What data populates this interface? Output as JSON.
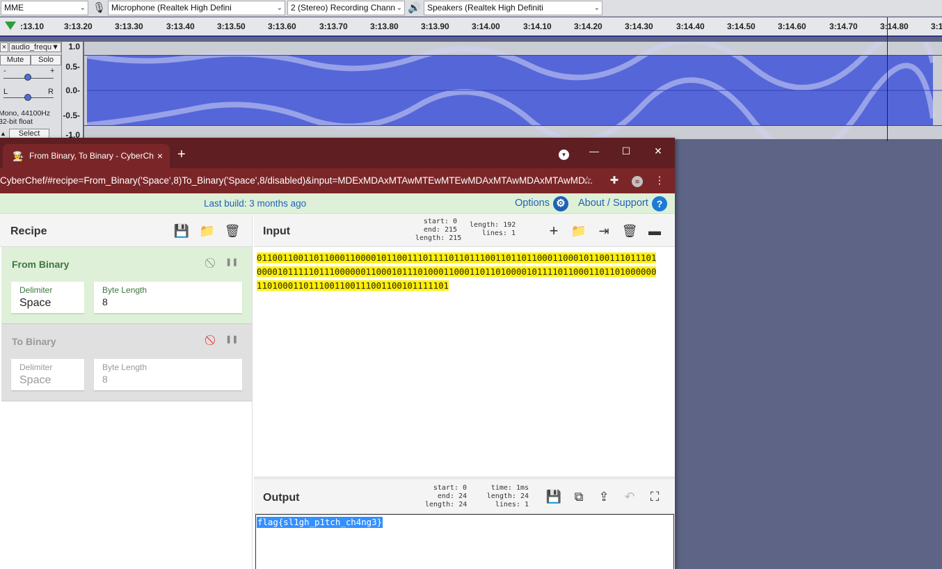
{
  "audacity": {
    "host": "MME",
    "mic_icon": "microphone-icon",
    "input_device": "Microphone (Realtek High Defini",
    "channels": "2 (Stereo) Recording Chann",
    "speaker_icon": "speaker-icon",
    "output_device": "Speakers (Realtek High Definiti",
    "ruler_ticks": [
      ":13.10",
      "3:13.20",
      "3:13.30",
      "3:13.40",
      "3:13.50",
      "3:13.60",
      "3:13.70",
      "3:13.80",
      "3:13.90",
      "3:14.00",
      "3:14.10",
      "3:14.20",
      "3:14.30",
      "3:14.40",
      "3:14.50",
      "3:14.60",
      "3:14.70",
      "3:14.80",
      "3:1"
    ],
    "track": {
      "close": "×",
      "name": "audio_frequ",
      "mute": "Mute",
      "solo": "Solo",
      "gain_minus": "-",
      "gain_plus": "+",
      "pan_left": "L",
      "pan_right": "R",
      "info_rate": "Mono, 44100Hz",
      "info_format": "32-bit float",
      "select": "Select"
    },
    "vscale": [
      "1.0",
      "0.5-",
      "0.0-",
      "-0.5-",
      "-1.0"
    ],
    "wave_color": "#5566d8"
  },
  "browser": {
    "tab_title": "From Binary, To Binary - CyberCh",
    "tab_close": "×",
    "new_tab": "+",
    "url": "CyberChef/#recipe=From_Binary('Space',8)To_Binary('Space',8/disabled)&input=MDExMDAxMTAwMTEwMTEwMDAxMTAwMDAxMTAwMD...",
    "theme_color": "#7a2628"
  },
  "cyberchef": {
    "last_build": "Last build: 3 months ago",
    "options": "Options",
    "about": "About / Support",
    "recipe_title": "Recipe",
    "ops": [
      {
        "name": "From Binary",
        "delimiter_label": "Delimiter",
        "delimiter": "Space",
        "bytelen_label": "Byte Length",
        "bytelen": "8"
      },
      {
        "name": "To Binary",
        "delimiter_label": "Delimiter",
        "delimiter": "Space",
        "bytelen_label": "Byte Length",
        "bytelen": "8"
      }
    ],
    "input_title": "Input",
    "input_stats": {
      "start_label": "start:",
      "start": "0",
      "end_label": "end:",
      "end": "215",
      "length_label": "length:",
      "length": "215",
      "len2_label": "length:",
      "len2": "192",
      "lines_label": "lines:",
      "lines": "1"
    },
    "input_lines": [
      "01100110011011000110000101100111011110110111001101101100011000101100111011101",
      "00001011111011100000011000101110100011000110110100001011110110001101101000000",
      "1101000110111001100111001100101111101"
    ],
    "output_title": "Output",
    "output_stats": {
      "start_label": "start:",
      "start": "0",
      "end_label": "end:",
      "end": "24",
      "length_label": "length:",
      "length": "24",
      "time_label": "time:",
      "time": "1ms",
      "len2_label": "length:",
      "len2": "24",
      "lines_label": "lines:",
      "lines": "1"
    },
    "output_text": "flag{sl1gh_p1tch_ch4ng3}"
  }
}
